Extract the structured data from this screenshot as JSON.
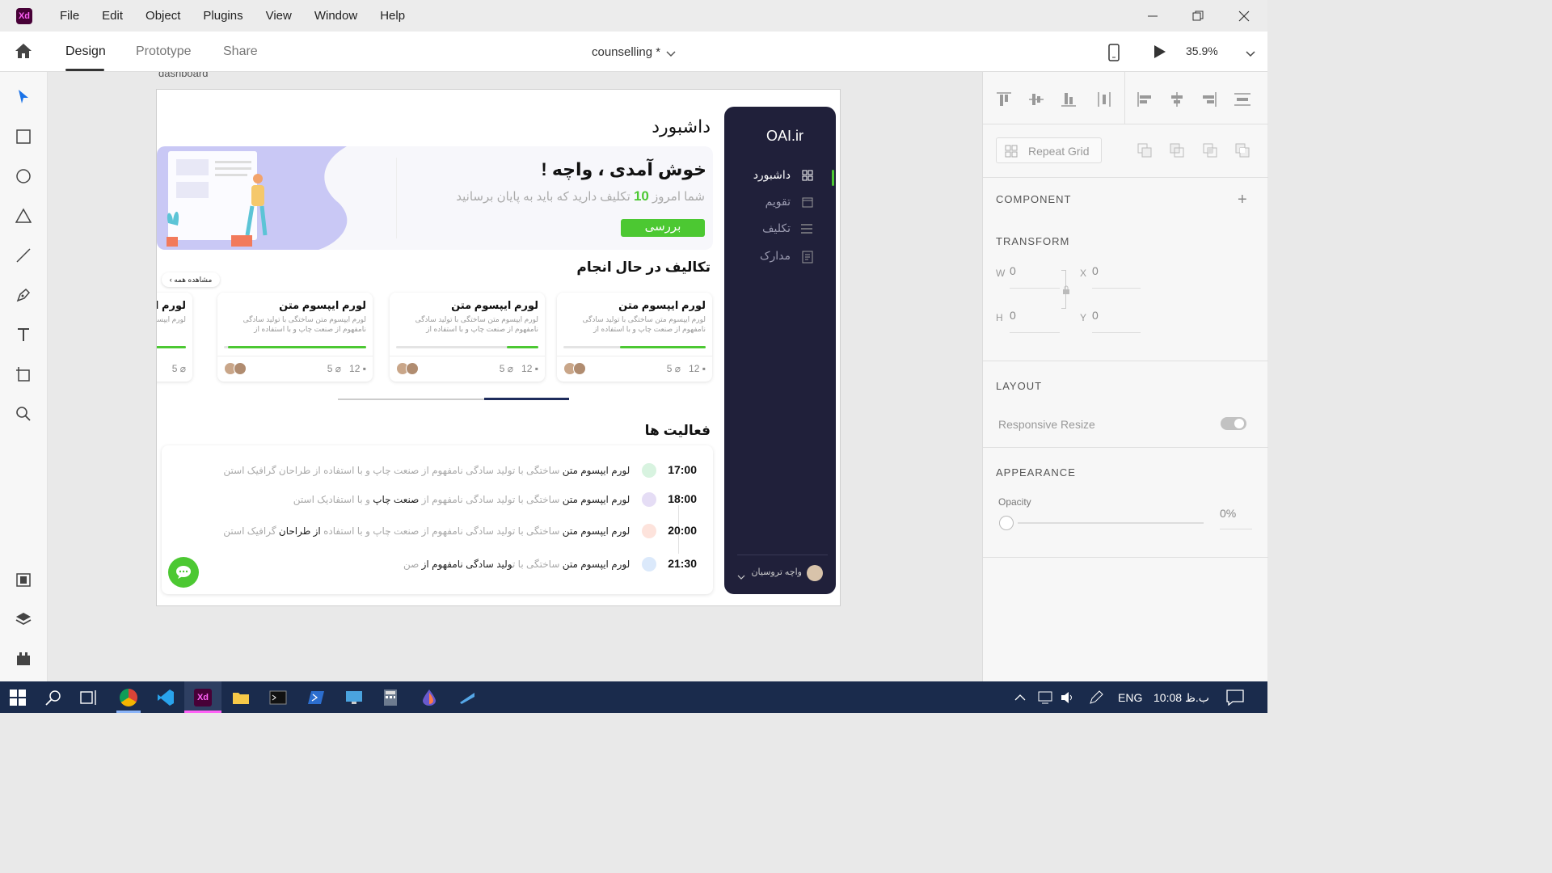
{
  "app": {
    "menu": [
      "File",
      "Edit",
      "Object",
      "Plugins",
      "View",
      "Window",
      "Help"
    ],
    "tabs": [
      "Design",
      "Prototype",
      "Share"
    ],
    "active_tab": "Design",
    "document_name": "counselling *",
    "zoom": "35.9%"
  },
  "canvas": {
    "artboard_label": "dashboard"
  },
  "dashboard": {
    "logo": "OAI.ir",
    "nav": [
      "داشبورد",
      "تقویم",
      "تکلیف",
      "مدارک"
    ],
    "user_name": "واچه تروسیان",
    "page_title": "داشبورد",
    "welcome_title": "خوش آمدی ، واچه !",
    "welcome_subtitle_prefix": "شما امروز",
    "welcome_count": "10",
    "welcome_subtitle_suffix": "تکلیف دارید که باید به پایان برسانید",
    "welcome_button": "بررسی",
    "tasks_heading": "تکالیف در حال انجام",
    "see_all": "مشاهده همه",
    "cards": [
      {
        "title": "لورم ایپسوم متن",
        "desc": "لورم ایپسوم متن ساختگی با تولید سادگی نامفهوم از صنعت چاپ و با استفاده از",
        "progress": 0.6,
        "comments": "12",
        "attachments": "5"
      },
      {
        "title": "لورم ایپسوم متن",
        "desc": "لورم ایپسوم متن ساختگی با تولید سادگی نامفهوم از صنعت چاپ و با استفاده از",
        "progress": 0.22,
        "comments": "12",
        "attachments": "5"
      },
      {
        "title": "لورم ایپسوم متن",
        "desc": "لورم ایپسوم متن ساختگی با تولید سادگی نامفهوم از صنعت چاپ و با استفاده از",
        "progress": 0.97,
        "comments": "12",
        "attachments": "5"
      },
      {
        "title": "لورم ایپ",
        "desc": "لورم ایپسوم نامفهوم از",
        "progress": 0.9,
        "comments": "",
        "attachments": "5"
      }
    ],
    "activities_heading": "فعالیت ها",
    "activities": [
      {
        "time": "17:00",
        "bold": "لورم ایپسوم متن",
        "text": "ساختگی با تولید سادگی نامفهوم از صنعت چاپ و با استفاده از طراحان گرافیک استن",
        "color": "#d8f3e0"
      },
      {
        "time": "18:00",
        "bold": "لورم ایپسوم متن",
        "text": "ساختگی با تولید سادگی نامفهوم از",
        "bold2": "صنعت چاپ",
        "text2": "و با استفادیک استن",
        "color": "#e5ddf5"
      },
      {
        "time": "20:00",
        "bold": "لورم ایپسوم متن",
        "text": "ساختگی با تولید سادگی نامفهوم از صنعت چاپ و با استفاده",
        "bold2": "از طراحان",
        "text2": "گرافیک استن",
        "color": "#fde3dc"
      },
      {
        "time": "21:30",
        "bold": "لورم ایپسوم متن",
        "text": "ساختگی با ت",
        "bold2": "ولید سادگی نامفهوم از",
        "text2": "صن",
        "color": "#dbe9fb"
      }
    ]
  },
  "right_panel": {
    "repeat_grid": "Repeat Grid",
    "component": "COMPONENT",
    "transform": "TRANSFORM",
    "w_label": "W",
    "w_value": "0",
    "x_label": "X",
    "x_value": "0",
    "h_label": "H",
    "h_value": "0",
    "y_label": "Y",
    "y_value": "0",
    "layout": "LAYOUT",
    "responsive_resize": "Responsive Resize",
    "appearance": "APPEARANCE",
    "opacity_label": "Opacity",
    "opacity_value": "0%"
  },
  "taskbar": {
    "language": "ENG",
    "time": "10:08 ب.ظ"
  }
}
